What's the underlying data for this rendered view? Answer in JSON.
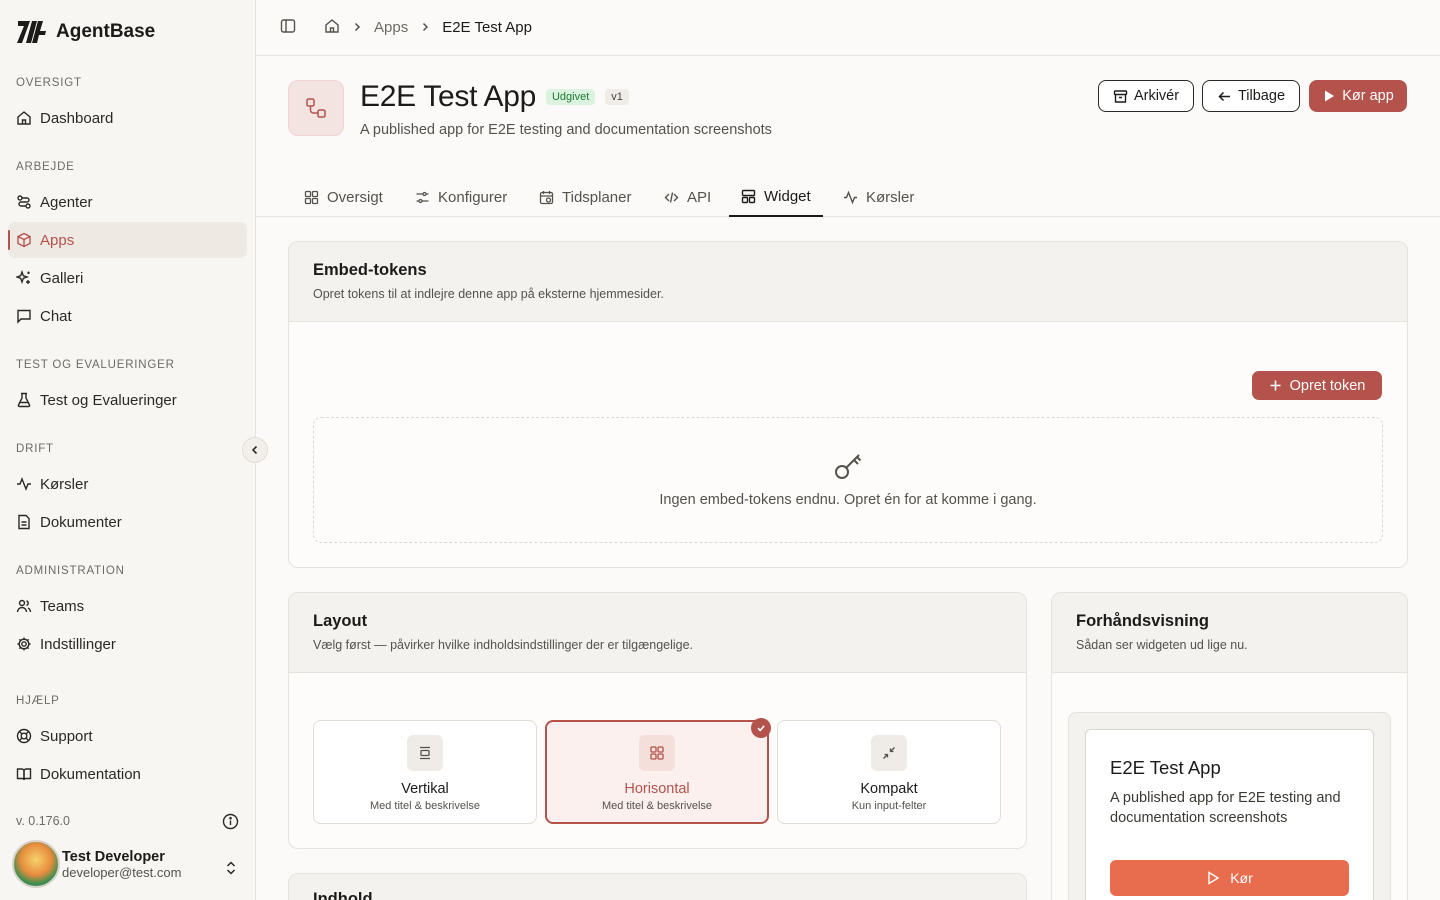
{
  "brand": {
    "name": "AgentBase",
    "logo_icon": "agentbase-logo"
  },
  "sidebar": {
    "sections": {
      "overview": "OVERSIGT",
      "work": "ARBEJDE",
      "test": "TEST OG EVALUERINGER",
      "ops": "DRIFT",
      "admin": "ADMINISTRATION",
      "help": "HJÆLP"
    },
    "items": {
      "dashboard": "Dashboard",
      "agents": "Agenter",
      "apps": "Apps",
      "gallery": "Galleri",
      "chat": "Chat",
      "tests": "Test og Evalueringer",
      "runs": "Kørsler",
      "documents": "Dokumenter",
      "teams": "Teams",
      "settings": "Indstillinger",
      "support": "Support",
      "docs": "Dokumentation"
    },
    "active_item": "apps",
    "version": "v. 0.176.0",
    "user": {
      "name": "Test Developer",
      "email": "developer@test.com"
    }
  },
  "breadcrumb": {
    "link": "Apps",
    "current": "E2E Test App"
  },
  "header": {
    "title": "E2E Test App",
    "status_badge": "Udgivet",
    "version_badge": "v1",
    "description": "A published app for E2E testing and documentation screenshots",
    "archive_label": "Arkivér",
    "back_label": "Tilbage",
    "run_label": "Kør app"
  },
  "tabs": {
    "overview": "Oversigt",
    "configure": "Konfigurer",
    "schedules": "Tidsplaner",
    "api": "API",
    "widget": "Widget",
    "runs": "Kørsler",
    "active": "widget"
  },
  "embed": {
    "title": "Embed-tokens",
    "subtitle": "Opret tokens til at indlejre denne app på eksterne hjemmesider.",
    "create_label": "Opret token",
    "empty_text": "Ingen embed-tokens endnu. Opret én for at komme i gang."
  },
  "layout": {
    "title": "Layout",
    "subtitle": "Vælg først — påvirker hvilke indholdsindstillinger der er tilgængelige.",
    "options": [
      {
        "title": "Vertikal",
        "sub": "Med titel & beskrivelse",
        "icon": "vertical-layout-icon"
      },
      {
        "title": "Horisontal",
        "sub": "Med titel & beskrivelse",
        "icon": "horizontal-layout-icon"
      },
      {
        "title": "Kompakt",
        "sub": "Kun input-felter",
        "icon": "compact-layout-icon"
      }
    ],
    "selected": "Horisontal"
  },
  "preview": {
    "title": "Forhåndsvisning",
    "subtitle": "Sådan ser widgeten ud lige nu.",
    "app_title": "E2E Test App",
    "app_desc": "A published app for E2E testing and documentation screenshots",
    "run_label": "Kør"
  },
  "content_section": {
    "title": "Indhold"
  },
  "colors": {
    "accent": "#b4524c",
    "preview_button": "#e86d4e",
    "published_badge": "#dcf4df"
  }
}
